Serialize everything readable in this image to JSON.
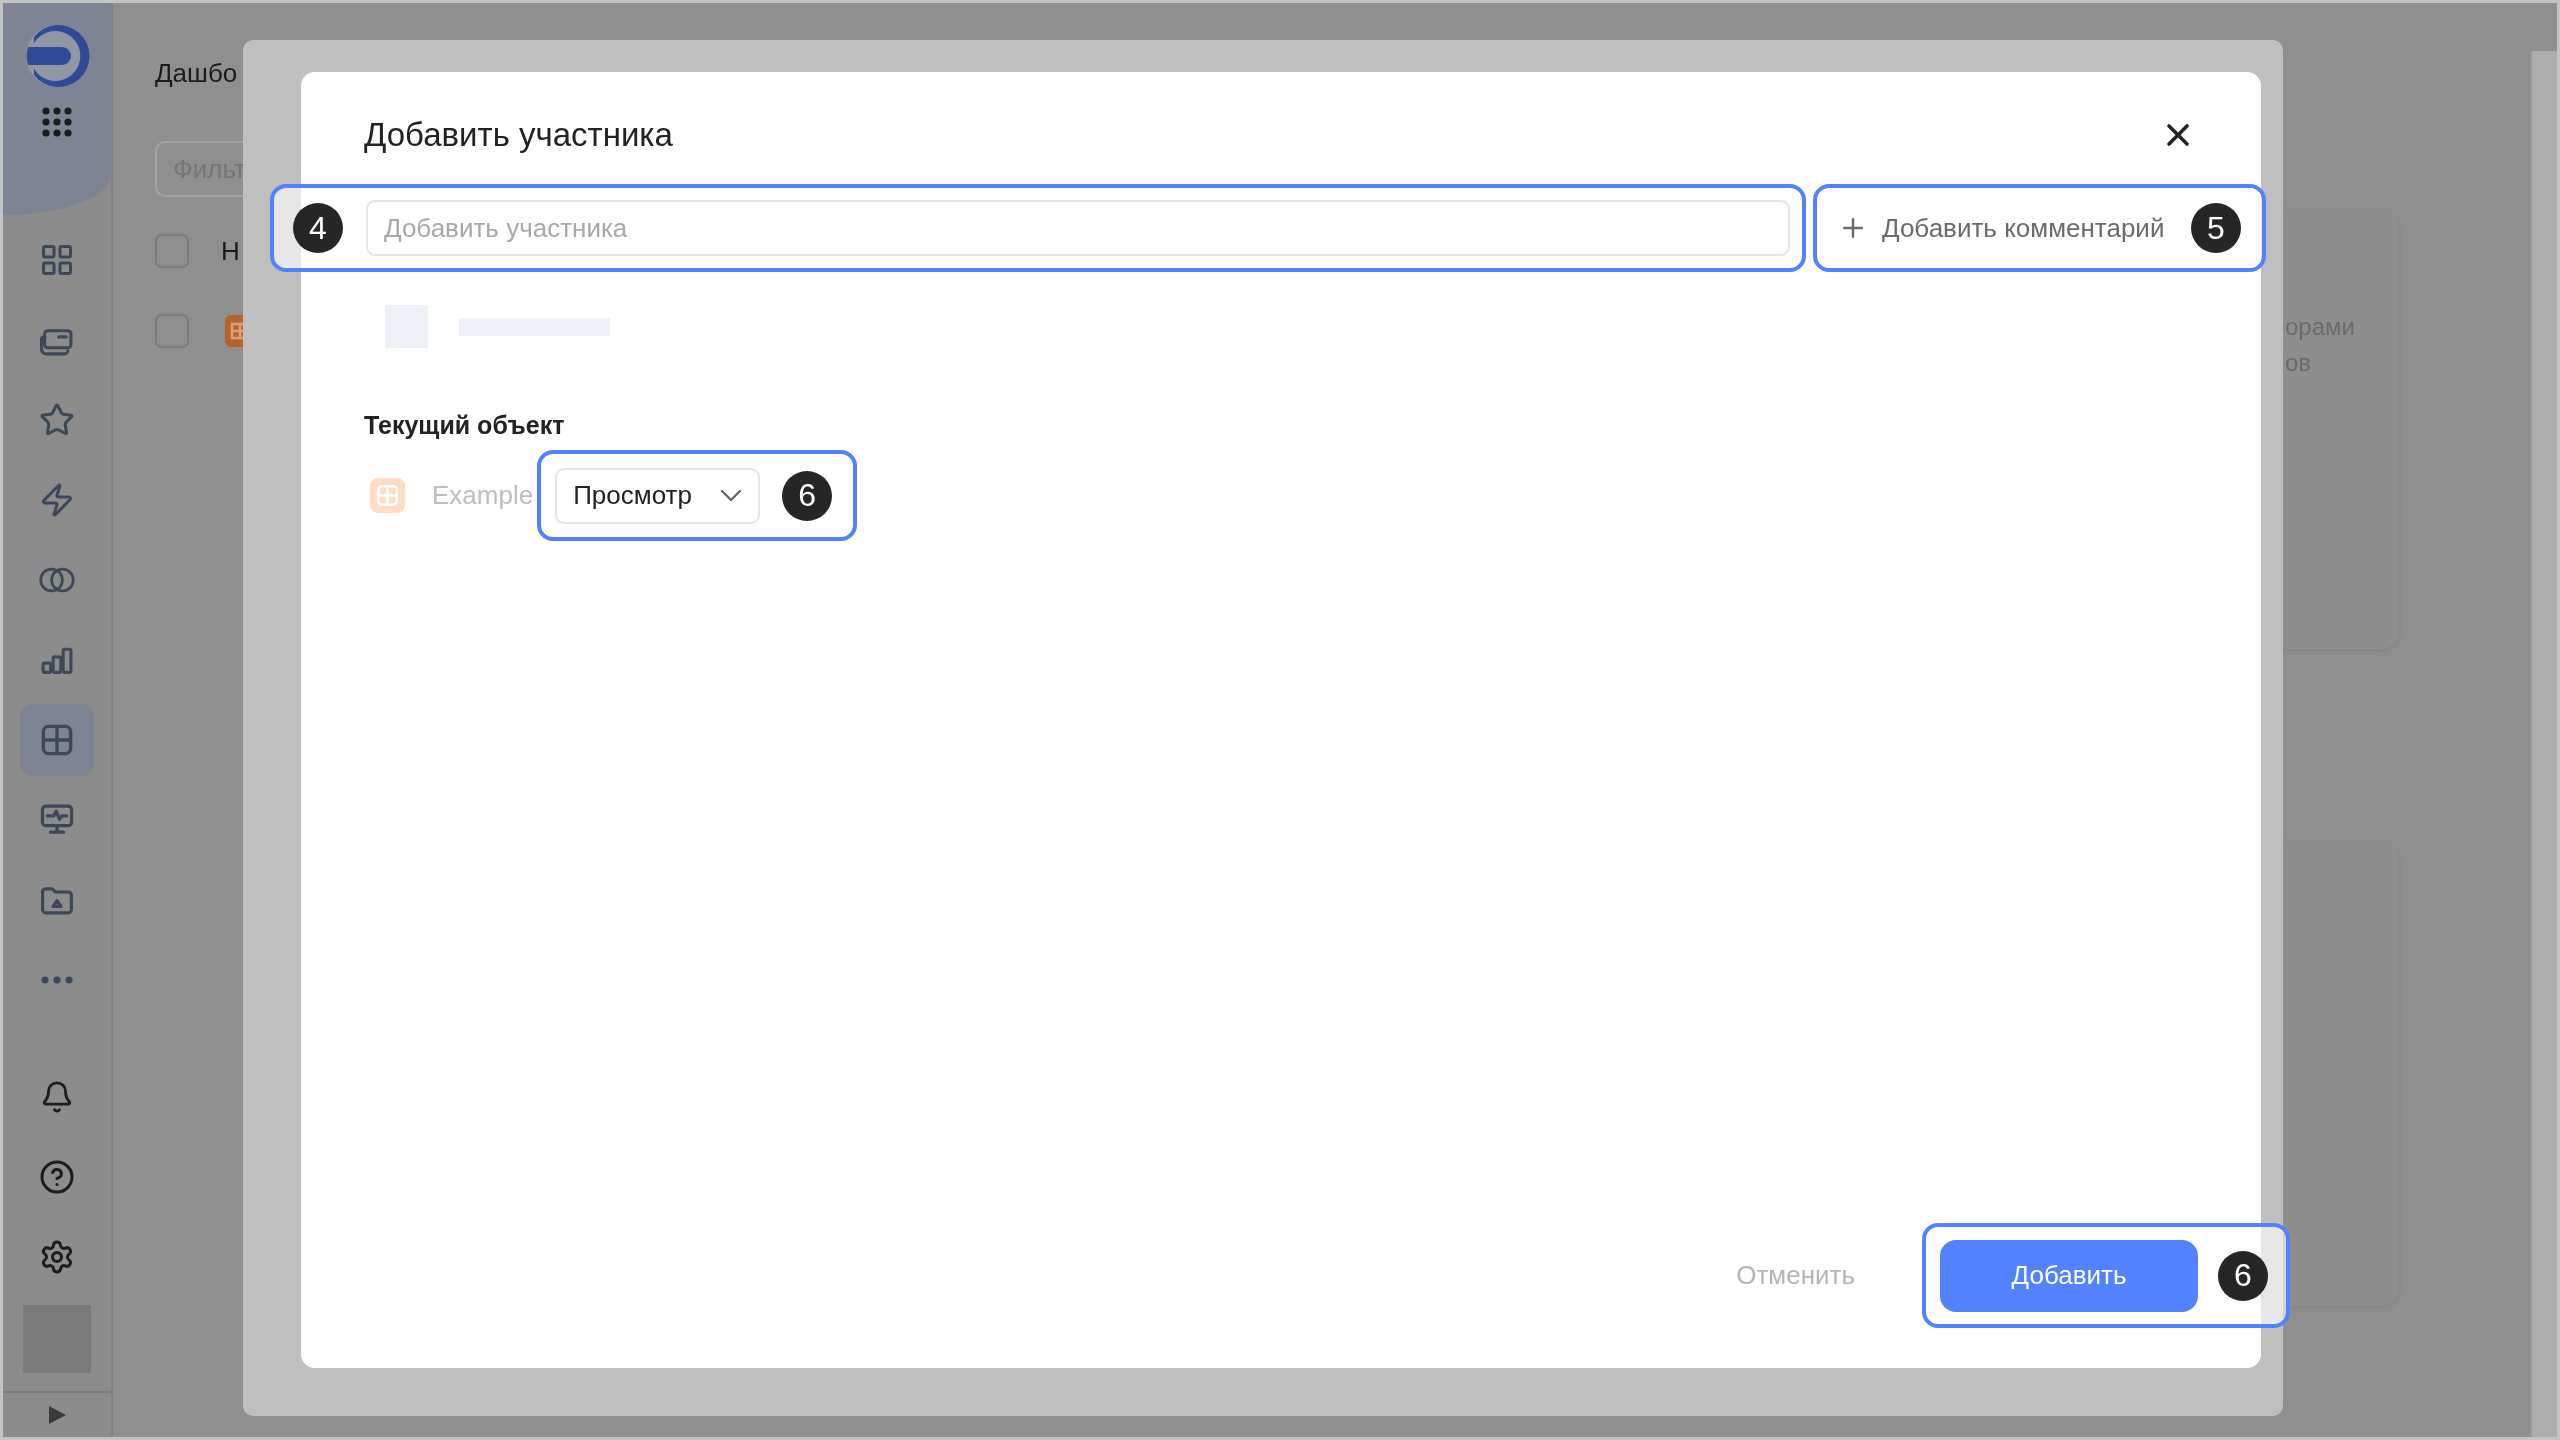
{
  "sidebar": {
    "items": [
      {
        "kind": "apps",
        "selected": false
      },
      {
        "kind": "folders",
        "selected": false
      },
      {
        "kind": "star",
        "selected": false
      },
      {
        "kind": "bolt",
        "selected": false
      },
      {
        "kind": "rings",
        "selected": false
      },
      {
        "kind": "bars",
        "selected": false
      },
      {
        "kind": "table",
        "selected": true
      },
      {
        "kind": "monitor",
        "selected": false
      },
      {
        "kind": "folder",
        "selected": false
      },
      {
        "kind": "more",
        "selected": false
      }
    ],
    "footer_items": [
      {
        "kind": "bell"
      },
      {
        "kind": "help"
      },
      {
        "kind": "settings"
      }
    ]
  },
  "page": {
    "title": "Дашбо",
    "filter": {
      "placeholder": "Фильт"
    },
    "rows": [
      {
        "checked": false,
        "kind": "text",
        "label": "Н"
      },
      {
        "checked": false,
        "kind": "table"
      }
    ],
    "card_lines": [
      "орами",
      "ов"
    ]
  },
  "dialog": {
    "title": "Добавить участника",
    "member_field": {
      "placeholder": "Добавить участника",
      "callout": "4"
    },
    "comment_button": {
      "label": "Добавить комментарий",
      "callout": "5"
    },
    "section_title": "Текущий объект",
    "object": {
      "name": "Example",
      "role": "Просмотр",
      "callout": "6"
    },
    "buttons": [
      {
        "kind": "cancel",
        "label": "Отменить",
        "disabled": true
      },
      {
        "kind": "primary",
        "label": "Добавить",
        "disabled": false,
        "callout": "6"
      }
    ]
  }
}
